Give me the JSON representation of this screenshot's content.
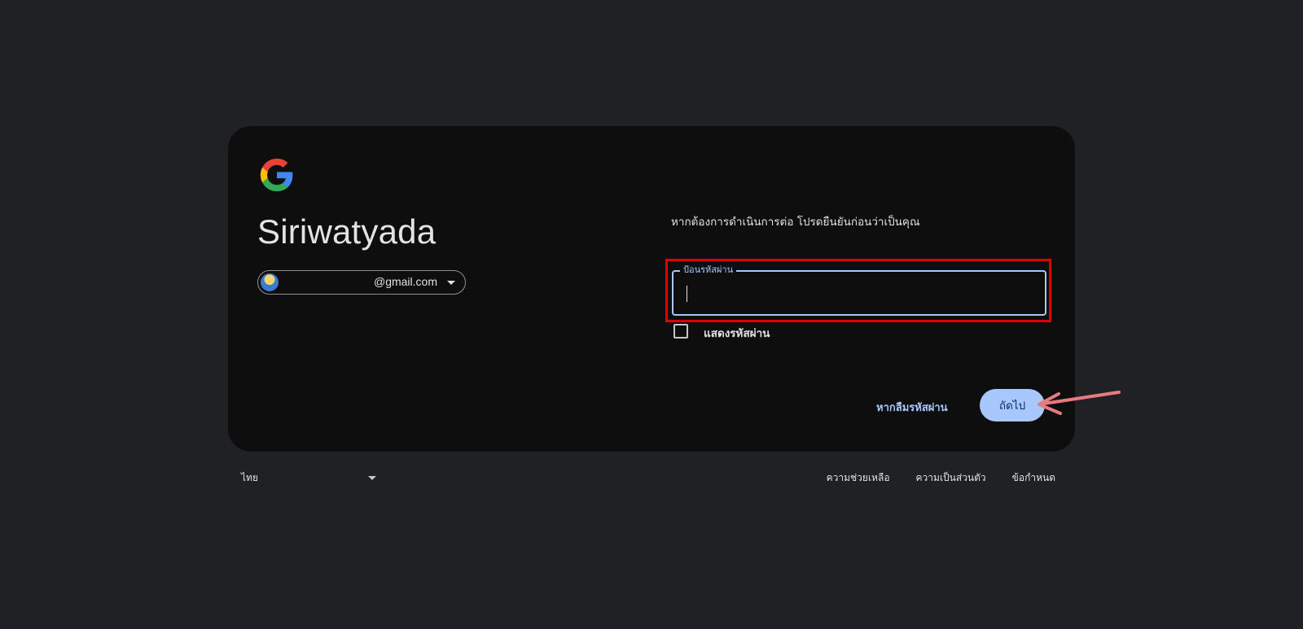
{
  "colors": {
    "page_bg": "#202124",
    "card_bg": "#0e0e0e",
    "accent": "#a8c7fa",
    "highlight": "#e00000",
    "arrow": "#e87a80"
  },
  "logo": {
    "icon": "google-g-icon"
  },
  "account": {
    "name": "Siriwatyada",
    "email": "@gmail.com"
  },
  "main": {
    "prompt": "หากต้องการดำเนินการต่อ โปรดยืนยันก่อนว่าเป็นคุณ",
    "password_label": "ป้อนรหัสผ่าน",
    "password_value": "",
    "show_password_label": "แสดงรหัสผ่าน",
    "forgot_password": "หากลืมรหัสผ่าน",
    "next_button": "ถัดไป"
  },
  "footer": {
    "language": "ไทย",
    "links": [
      "ความช่วยเหลือ",
      "ความเป็นส่วนตัว",
      "ข้อกำหนด"
    ]
  }
}
